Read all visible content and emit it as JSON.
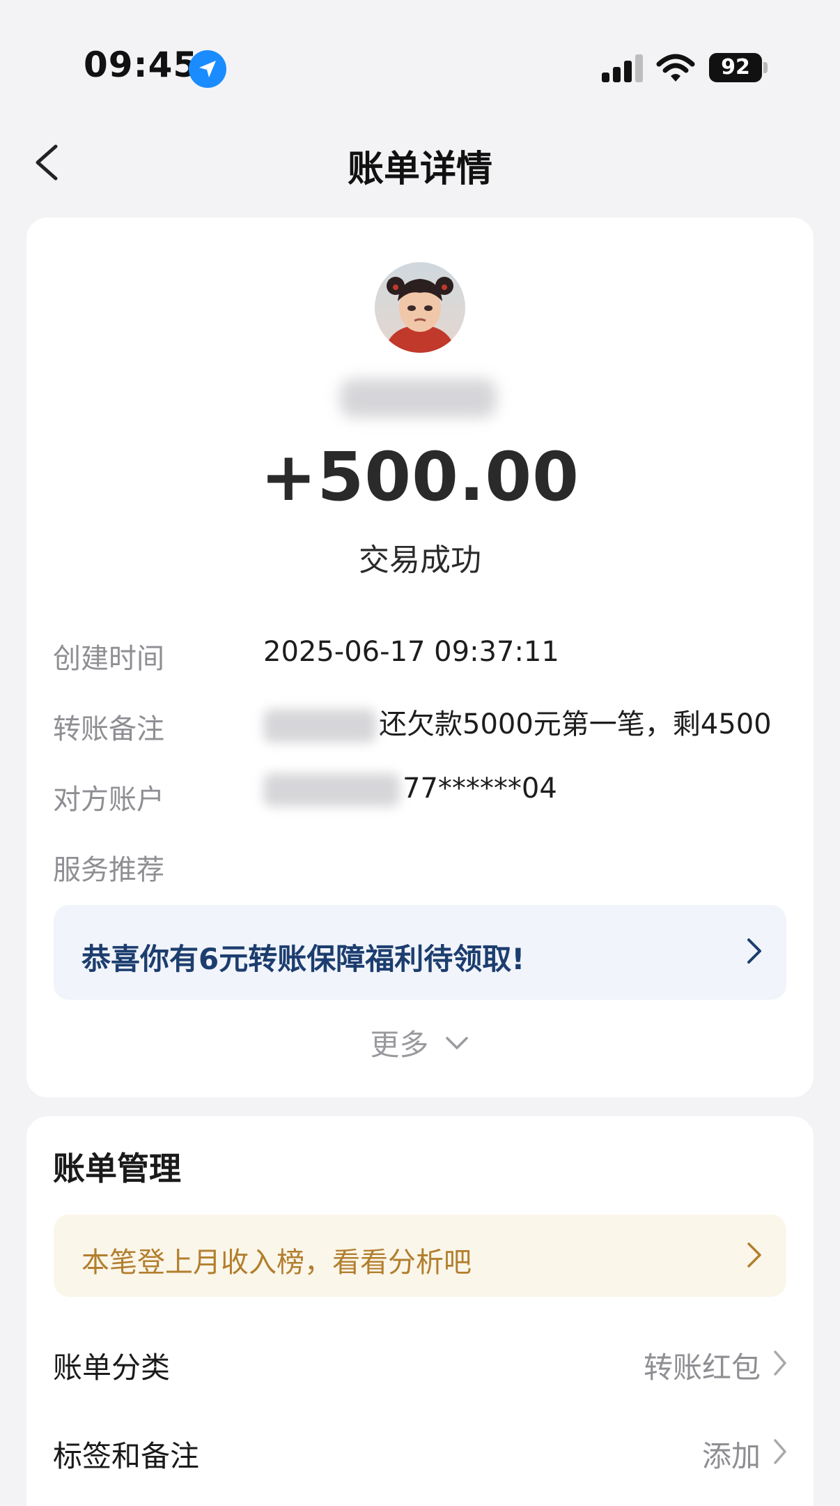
{
  "status_bar": {
    "time": "09:45",
    "battery": "92",
    "icons": [
      "location-arrow-icon",
      "cellular-signal-icon",
      "wifi-icon",
      "battery-icon"
    ]
  },
  "nav": {
    "title": "账单详情",
    "back_icon": "chevron-left-icon"
  },
  "summary": {
    "amount": "+500.00",
    "status": "交易成功"
  },
  "details": [
    {
      "label": "创建时间",
      "value": "2025-06-17 09:37:11"
    },
    {
      "label": "转账备注",
      "value": "还欠款5000元第一笔，剩4500"
    },
    {
      "label": "对方账户",
      "value": "77******04"
    },
    {
      "label": "服务推荐",
      "value": ""
    }
  ],
  "promo_banner": {
    "text": "恭喜你有6元转账保障福利待领取!"
  },
  "more": {
    "label": "更多",
    "icon": "chevron-down-icon"
  },
  "manage": {
    "title": "账单管理",
    "banner_text": "本笔登上月收入榜，看看分析吧",
    "rows": [
      {
        "label": "账单分类",
        "value": "转账红包"
      },
      {
        "label": "标签和备注",
        "value": "添加"
      }
    ]
  },
  "colors": {
    "background": "#f3f3f5",
    "card": "#ffffff",
    "promo_text": "#1c3d6e",
    "promo_bg": "#f1f4fa",
    "gold_text": "#b27f2e",
    "gold_bg": "#fbf6ea",
    "location_blue": "#1a8cff"
  }
}
